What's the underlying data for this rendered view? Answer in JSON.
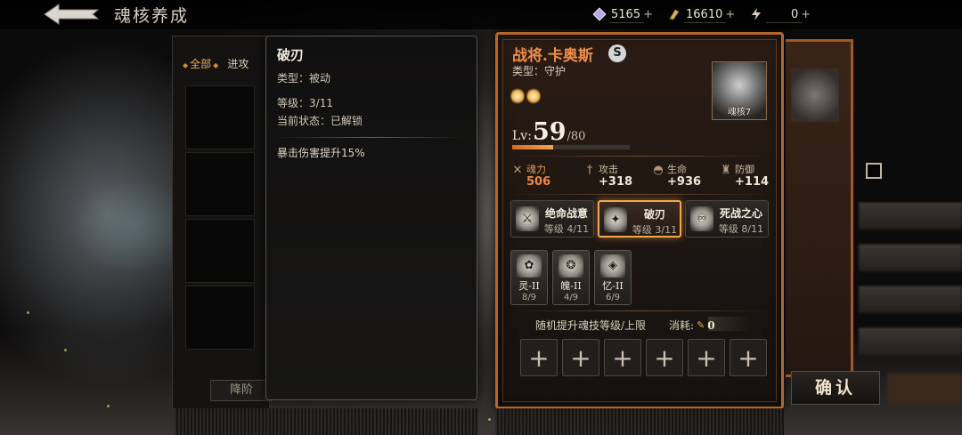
{
  "header": {
    "title": "魂核养成",
    "back_icon": "back-arrow-icon"
  },
  "resources": [
    {
      "icon": "crystal-icon",
      "value": "5165",
      "plus": "+"
    },
    {
      "icon": "gold-coin-icon",
      "value": "16610",
      "plus": "+"
    },
    {
      "icon": "energy-bolt-icon",
      "value": "0",
      "plus": "+"
    }
  ],
  "list_panel": {
    "filter_all": "全部",
    "filter_attack": "进攻",
    "downgrade_button": "降阶"
  },
  "tooltip": {
    "name": "破刃",
    "type_label": "类型：",
    "type_value": "被动",
    "level_label": "等级：",
    "level_value": "3/11",
    "status_label": "当前状态：",
    "status_value": "已解锁",
    "description": "暴击伤害提升15%"
  },
  "character": {
    "name": "战将.卡奥斯",
    "rarity_badge": "S",
    "type_label": "类型：",
    "type_value": "守护",
    "portrait_label": "魂核7",
    "level_prefix": "Lv:",
    "level": "59",
    "level_max": "/80",
    "exp_progress": 0.35,
    "stats": [
      {
        "label": "魂力",
        "value": "506",
        "icon": "soul-power-icon"
      },
      {
        "label": "攻击",
        "value": "+318",
        "icon": "sword-icon"
      },
      {
        "label": "生命",
        "value": "+936",
        "icon": "helmet-icon"
      },
      {
        "label": "防御",
        "value": "+114",
        "icon": "armor-icon"
      }
    ],
    "skills": [
      {
        "name": "绝命战意",
        "level": "等级 4/11",
        "selected": false
      },
      {
        "name": "破刃",
        "level": "等级 3/11",
        "selected": true
      },
      {
        "name": "死战之心",
        "level": "等级 8/11",
        "selected": false
      }
    ],
    "runes": [
      {
        "name": "灵-II",
        "count": "8/9"
      },
      {
        "name": "魄-II",
        "count": "4/9"
      },
      {
        "name": "忆-II",
        "count": "6/9"
      }
    ],
    "upgrade_label": "随机提升魂技等级/上限",
    "cost_label": "消耗:",
    "cost_value": "0",
    "add_slot_symbol": "+"
  },
  "actions": {
    "confirm_button": "确认"
  },
  "colors": {
    "accent_orange": "#b5672b",
    "highlight": "#f3a64c"
  }
}
